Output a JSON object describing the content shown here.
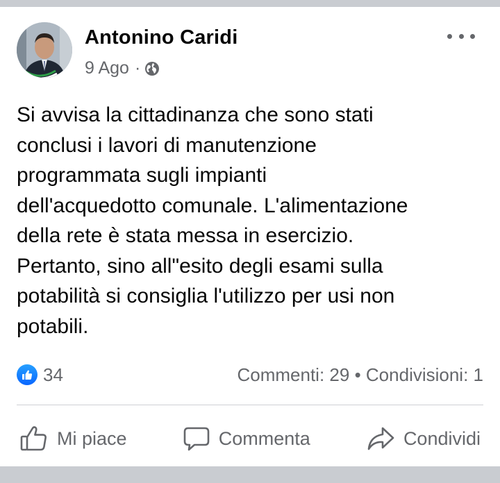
{
  "post": {
    "author": "Antonino Caridi",
    "time": "9 Ago",
    "separator": "·",
    "privacy_icon": "globe-icon",
    "more_icon": "more-horizontal-icon",
    "text": "Si avvisa la cittadinanza che sono stati\nconclusi i lavori di manutenzione\nprogrammata sugli impianti\ndell'acquedotto comunale. L'alimentazione\ndella rete è stata messa in esercizio.\nPertanto, sino all\"esito degli esami sulla\npotabilità si consiglia l'utilizzo per usi non\npotabili."
  },
  "stats": {
    "reaction_icon": "like-reaction-icon",
    "reactions_count": "34",
    "comments_label": "Commenti: 29",
    "bullet": "•",
    "shares_label": "Condivisioni: 1"
  },
  "actions": {
    "like_label": "Mi piace",
    "comment_label": "Commenta",
    "share_label": "Condividi"
  },
  "colors": {
    "page_background": "#c9ccd1",
    "card_background": "#ffffff",
    "primary_text": "#050505",
    "secondary_text": "#65676b",
    "like_blue": "#0866ff",
    "divider": "#ced0d4"
  }
}
